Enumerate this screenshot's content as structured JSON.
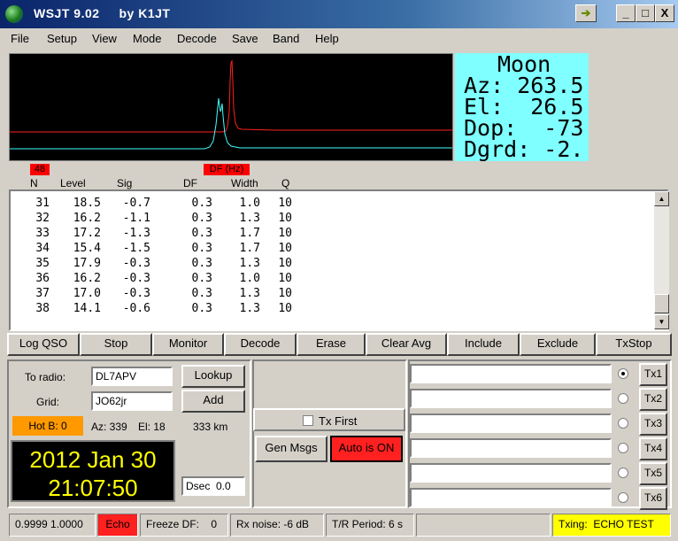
{
  "window": {
    "title": "WSJT 9.02     by K1JT",
    "arrow_btn": "➔",
    "min_btn": "_",
    "max_btn": "□",
    "close_btn": "X"
  },
  "menu": [
    "File",
    "Setup",
    "View",
    "Mode",
    "Decode",
    "Save",
    "Band",
    "Help"
  ],
  "moon": {
    "title": "Moon",
    "az": "Az: 263.5",
    "el": "El:  26.5",
    "dop": "Dop:  -73",
    "dgrd": "Dgrd: -2."
  },
  "tags": {
    "n_value": "48",
    "df_label": "DF (Hz)"
  },
  "columns": [
    "N",
    "Level",
    "Sig",
    "DF",
    "Width",
    "Q"
  ],
  "rows": [
    [
      "31",
      "18.5",
      "-0.7",
      "0.3",
      "1.0",
      "10"
    ],
    [
      "32",
      "16.2",
      "-1.1",
      "0.3",
      "1.3",
      "10"
    ],
    [
      "33",
      "17.2",
      "-1.3",
      "0.3",
      "1.7",
      "10"
    ],
    [
      "34",
      "15.4",
      "-1.5",
      "0.3",
      "1.7",
      "10"
    ],
    [
      "35",
      "17.9",
      "-0.3",
      "0.3",
      "1.3",
      "10"
    ],
    [
      "36",
      "16.2",
      "-0.3",
      "0.3",
      "1.0",
      "10"
    ],
    [
      "37",
      "17.0",
      "-0.3",
      "0.3",
      "1.3",
      "10"
    ],
    [
      "38",
      "14.1",
      "-0.6",
      "0.3",
      "1.3",
      "10"
    ]
  ],
  "buttons": [
    "Log QSO",
    "Stop",
    "Monitor",
    "Decode",
    "Erase",
    "Clear Avg",
    "Include",
    "Exclude",
    "TxStop"
  ],
  "station": {
    "to_radio_label": "To radio:",
    "to_radio_value": "DL7APV",
    "grid_label": "Grid:",
    "grid_value": "JO62jr",
    "lookup": "Lookup",
    "add": "Add",
    "hot_b": "Hot B: 0",
    "az": "Az: 339",
    "el": "El: 18",
    "dist": "333 km"
  },
  "clock": {
    "date": "2012 Jan 30",
    "time": "21:07:50"
  },
  "dsec": "Dsec  0.0",
  "tx_first": "Tx First",
  "gen_msgs": "Gen Msgs",
  "auto_is": "Auto is  ON",
  "tx_buttons": [
    "Tx1",
    "Tx2",
    "Tx3",
    "Tx4",
    "Tx5",
    "Tx6"
  ],
  "tx_messages": [
    "",
    "",
    "",
    "",
    "",
    ""
  ],
  "status": {
    "levels": "0.9999 1.0000",
    "mode": "Echo",
    "freeze": "Freeze DF:    0",
    "rx_noise": "Rx noise: -6 dB",
    "tr_period": "T/R Period: 6 s",
    "txing": "Txing:  ECHO TEST"
  },
  "colors": {
    "moon_bg": "#7fffff",
    "red_tag": "#ff0000",
    "hot_b": "#ff9900",
    "txing_bg": "#ffff00",
    "clock_fg": "#ffff00"
  }
}
